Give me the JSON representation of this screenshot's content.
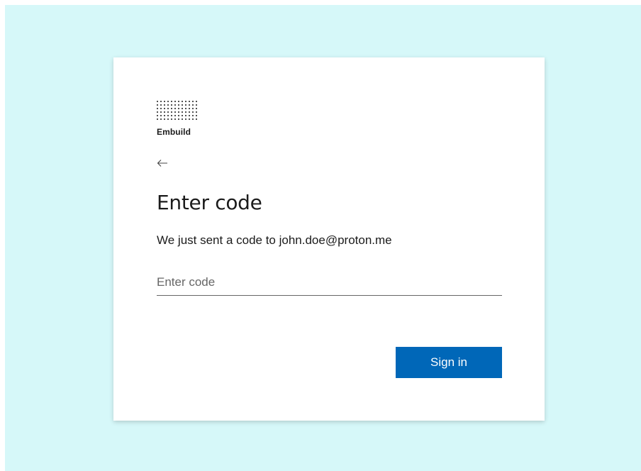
{
  "brand": {
    "name": "Embuild",
    "logo_icon": "dot-grid-logo-icon"
  },
  "nav": {
    "back_icon": "arrow-left-icon"
  },
  "page": {
    "title": "Enter code",
    "subtitle": "We just sent a code to john.doe@proton.me"
  },
  "form": {
    "code_value": "",
    "code_placeholder": "Enter code",
    "submit_label": "Sign in"
  },
  "colors": {
    "background": "#d6f8f9",
    "card": "#ffffff",
    "primary_button": "#0067b8",
    "text": "#1b1b1b"
  }
}
